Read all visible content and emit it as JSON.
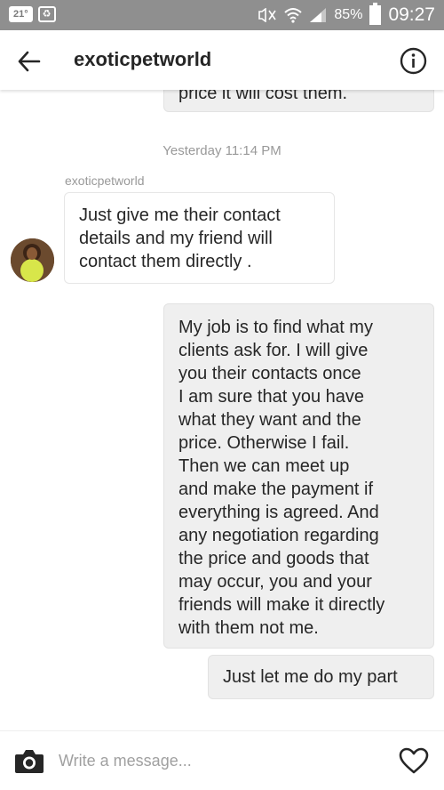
{
  "status_bar": {
    "temperature": "21°",
    "notification_icon": "recycle-icon",
    "battery": "85%",
    "time": "09:27"
  },
  "header": {
    "title": "exoticpetworld",
    "back_icon": "back-arrow-icon",
    "info_icon": "info-icon"
  },
  "conversation": {
    "partial_message": "price it will cost them.",
    "timestamp": "Yesterday 11:14 PM",
    "sender_name": "exoticpetworld",
    "messages": [
      {
        "from": "them",
        "lines": [
          "Just give me their contact",
          "details and my friend will",
          "contact them directly ."
        ]
      },
      {
        "from": "me",
        "lines": [
          "My job is to find what my",
          "clients ask for. I will give",
          "you their contacts once",
          "I am sure that you have",
          "what they want and the",
          "price. Otherwise I fail.",
          "Then we can meet up",
          "and make the payment if",
          "everything is agreed. And",
          "any negotiation regarding",
          "the price and goods that",
          "may occur, you and your",
          "friends will make it directly",
          "with them not me."
        ]
      },
      {
        "from": "me",
        "lines": [
          "Just let me do my part"
        ]
      }
    ]
  },
  "composer": {
    "placeholder": "Write a message...",
    "camera_icon": "camera-icon",
    "heart_icon": "heart-icon"
  },
  "colors": {
    "status_bar_bg": "#8f8f8f",
    "outgoing_bubble": "#efefef",
    "incoming_bubble": "#ffffff",
    "meta_text": "#999999"
  }
}
